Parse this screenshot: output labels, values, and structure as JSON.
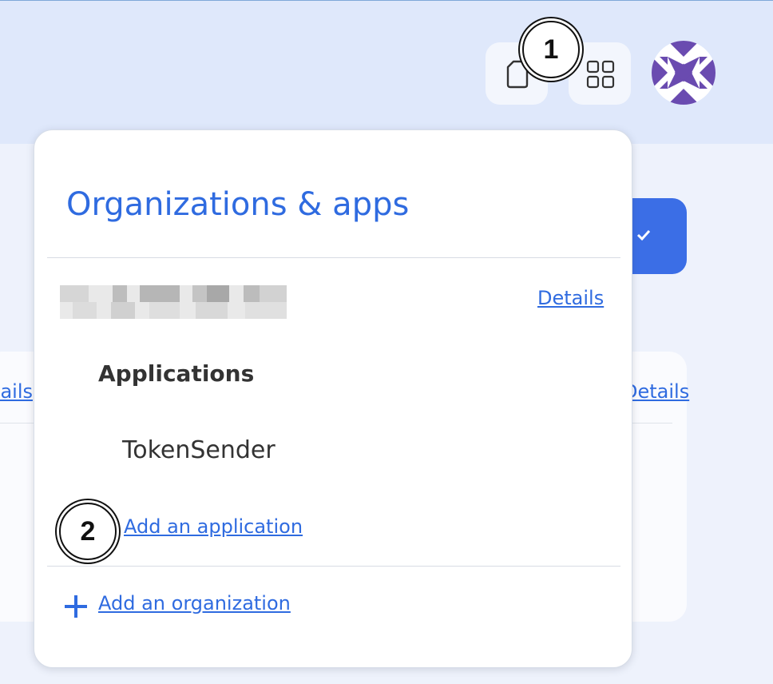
{
  "header": {
    "doc_button_icon": "document-icon",
    "apps_button_icon": "apps-grid-icon",
    "avatar_icon": "identicon-avatar"
  },
  "background": {
    "left_link_label": "Details",
    "right_link_label": "Details"
  },
  "popup": {
    "title": "Organizations & apps",
    "org_name": "",
    "details_label": "Details",
    "applications_heading": "Applications",
    "applications": [
      "TokenSender"
    ],
    "add_application_label": "Add an application",
    "add_organization_label": "Add an organization",
    "add_organization_icon": "plus-icon"
  },
  "callouts": [
    "1",
    "2"
  ],
  "colors": {
    "accent": "#2f6be0",
    "header_bg": "#dfe8fb",
    "page_bg": "#eef2fc",
    "avatar": "#6a4bb0",
    "primary_button": "#3b6ee6"
  }
}
